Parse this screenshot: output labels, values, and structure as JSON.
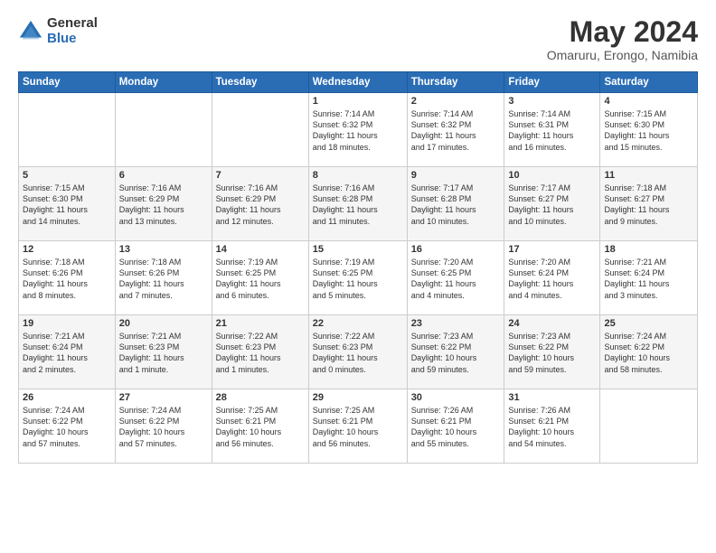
{
  "logo": {
    "general": "General",
    "blue": "Blue"
  },
  "title": {
    "month_year": "May 2024",
    "location": "Omaruru, Erongo, Namibia"
  },
  "days_of_week": [
    "Sunday",
    "Monday",
    "Tuesday",
    "Wednesday",
    "Thursday",
    "Friday",
    "Saturday"
  ],
  "weeks": [
    [
      {
        "day": "",
        "info": ""
      },
      {
        "day": "",
        "info": ""
      },
      {
        "day": "",
        "info": ""
      },
      {
        "day": "1",
        "info": "Sunrise: 7:14 AM\nSunset: 6:32 PM\nDaylight: 11 hours\nand 18 minutes."
      },
      {
        "day": "2",
        "info": "Sunrise: 7:14 AM\nSunset: 6:32 PM\nDaylight: 11 hours\nand 17 minutes."
      },
      {
        "day": "3",
        "info": "Sunrise: 7:14 AM\nSunset: 6:31 PM\nDaylight: 11 hours\nand 16 minutes."
      },
      {
        "day": "4",
        "info": "Sunrise: 7:15 AM\nSunset: 6:30 PM\nDaylight: 11 hours\nand 15 minutes."
      }
    ],
    [
      {
        "day": "5",
        "info": "Sunrise: 7:15 AM\nSunset: 6:30 PM\nDaylight: 11 hours\nand 14 minutes."
      },
      {
        "day": "6",
        "info": "Sunrise: 7:16 AM\nSunset: 6:29 PM\nDaylight: 11 hours\nand 13 minutes."
      },
      {
        "day": "7",
        "info": "Sunrise: 7:16 AM\nSunset: 6:29 PM\nDaylight: 11 hours\nand 12 minutes."
      },
      {
        "day": "8",
        "info": "Sunrise: 7:16 AM\nSunset: 6:28 PM\nDaylight: 11 hours\nand 11 minutes."
      },
      {
        "day": "9",
        "info": "Sunrise: 7:17 AM\nSunset: 6:28 PM\nDaylight: 11 hours\nand 10 minutes."
      },
      {
        "day": "10",
        "info": "Sunrise: 7:17 AM\nSunset: 6:27 PM\nDaylight: 11 hours\nand 10 minutes."
      },
      {
        "day": "11",
        "info": "Sunrise: 7:18 AM\nSunset: 6:27 PM\nDaylight: 11 hours\nand 9 minutes."
      }
    ],
    [
      {
        "day": "12",
        "info": "Sunrise: 7:18 AM\nSunset: 6:26 PM\nDaylight: 11 hours\nand 8 minutes."
      },
      {
        "day": "13",
        "info": "Sunrise: 7:18 AM\nSunset: 6:26 PM\nDaylight: 11 hours\nand 7 minutes."
      },
      {
        "day": "14",
        "info": "Sunrise: 7:19 AM\nSunset: 6:25 PM\nDaylight: 11 hours\nand 6 minutes."
      },
      {
        "day": "15",
        "info": "Sunrise: 7:19 AM\nSunset: 6:25 PM\nDaylight: 11 hours\nand 5 minutes."
      },
      {
        "day": "16",
        "info": "Sunrise: 7:20 AM\nSunset: 6:25 PM\nDaylight: 11 hours\nand 4 minutes."
      },
      {
        "day": "17",
        "info": "Sunrise: 7:20 AM\nSunset: 6:24 PM\nDaylight: 11 hours\nand 4 minutes."
      },
      {
        "day": "18",
        "info": "Sunrise: 7:21 AM\nSunset: 6:24 PM\nDaylight: 11 hours\nand 3 minutes."
      }
    ],
    [
      {
        "day": "19",
        "info": "Sunrise: 7:21 AM\nSunset: 6:24 PM\nDaylight: 11 hours\nand 2 minutes."
      },
      {
        "day": "20",
        "info": "Sunrise: 7:21 AM\nSunset: 6:23 PM\nDaylight: 11 hours\nand 1 minute."
      },
      {
        "day": "21",
        "info": "Sunrise: 7:22 AM\nSunset: 6:23 PM\nDaylight: 11 hours\nand 1 minutes."
      },
      {
        "day": "22",
        "info": "Sunrise: 7:22 AM\nSunset: 6:23 PM\nDaylight: 11 hours\nand 0 minutes."
      },
      {
        "day": "23",
        "info": "Sunrise: 7:23 AM\nSunset: 6:22 PM\nDaylight: 10 hours\nand 59 minutes."
      },
      {
        "day": "24",
        "info": "Sunrise: 7:23 AM\nSunset: 6:22 PM\nDaylight: 10 hours\nand 59 minutes."
      },
      {
        "day": "25",
        "info": "Sunrise: 7:24 AM\nSunset: 6:22 PM\nDaylight: 10 hours\nand 58 minutes."
      }
    ],
    [
      {
        "day": "26",
        "info": "Sunrise: 7:24 AM\nSunset: 6:22 PM\nDaylight: 10 hours\nand 57 minutes."
      },
      {
        "day": "27",
        "info": "Sunrise: 7:24 AM\nSunset: 6:22 PM\nDaylight: 10 hours\nand 57 minutes."
      },
      {
        "day": "28",
        "info": "Sunrise: 7:25 AM\nSunset: 6:21 PM\nDaylight: 10 hours\nand 56 minutes."
      },
      {
        "day": "29",
        "info": "Sunrise: 7:25 AM\nSunset: 6:21 PM\nDaylight: 10 hours\nand 56 minutes."
      },
      {
        "day": "30",
        "info": "Sunrise: 7:26 AM\nSunset: 6:21 PM\nDaylight: 10 hours\nand 55 minutes."
      },
      {
        "day": "31",
        "info": "Sunrise: 7:26 AM\nSunset: 6:21 PM\nDaylight: 10 hours\nand 54 minutes."
      },
      {
        "day": "",
        "info": ""
      }
    ]
  ]
}
